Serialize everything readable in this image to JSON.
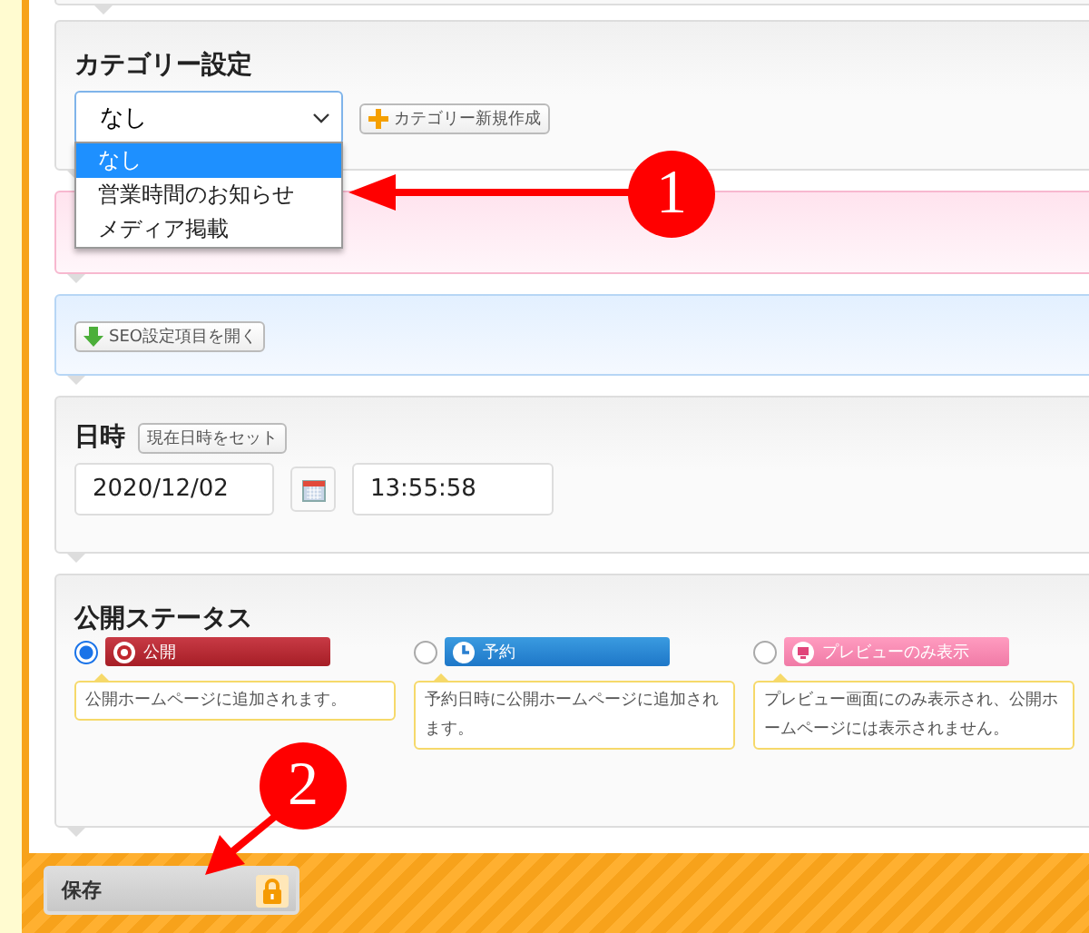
{
  "category": {
    "title": "カテゴリー設定",
    "value": "なし",
    "new_button": "カテゴリー新規作成",
    "options": [
      {
        "label": "なし",
        "selected": true
      },
      {
        "label": "営業時間のお知らせ",
        "selected": false
      },
      {
        "label": "メディア掲載",
        "selected": false
      }
    ]
  },
  "seo_button": "SEO設定項目を開く",
  "datetime": {
    "title": "日時",
    "now_button": "現在日時をセット",
    "date": "2020/12/02",
    "time": "13:55:58"
  },
  "status": {
    "title": "公開ステータス",
    "options": [
      {
        "kind": "public",
        "label": "公開",
        "selected": true,
        "description": "公開ホームページに追加されます。"
      },
      {
        "kind": "scheduled",
        "label": "予約",
        "selected": false,
        "description": "予約日時に公開ホームページに追加されます。"
      },
      {
        "kind": "preview",
        "label": "プレビューのみ表示",
        "selected": false,
        "description": "プレビュー画面にのみ表示され、公開ホームページには表示されません。"
      }
    ]
  },
  "save_button": "保存",
  "annotations": [
    {
      "number": "1"
    },
    {
      "number": "2"
    }
  ]
}
